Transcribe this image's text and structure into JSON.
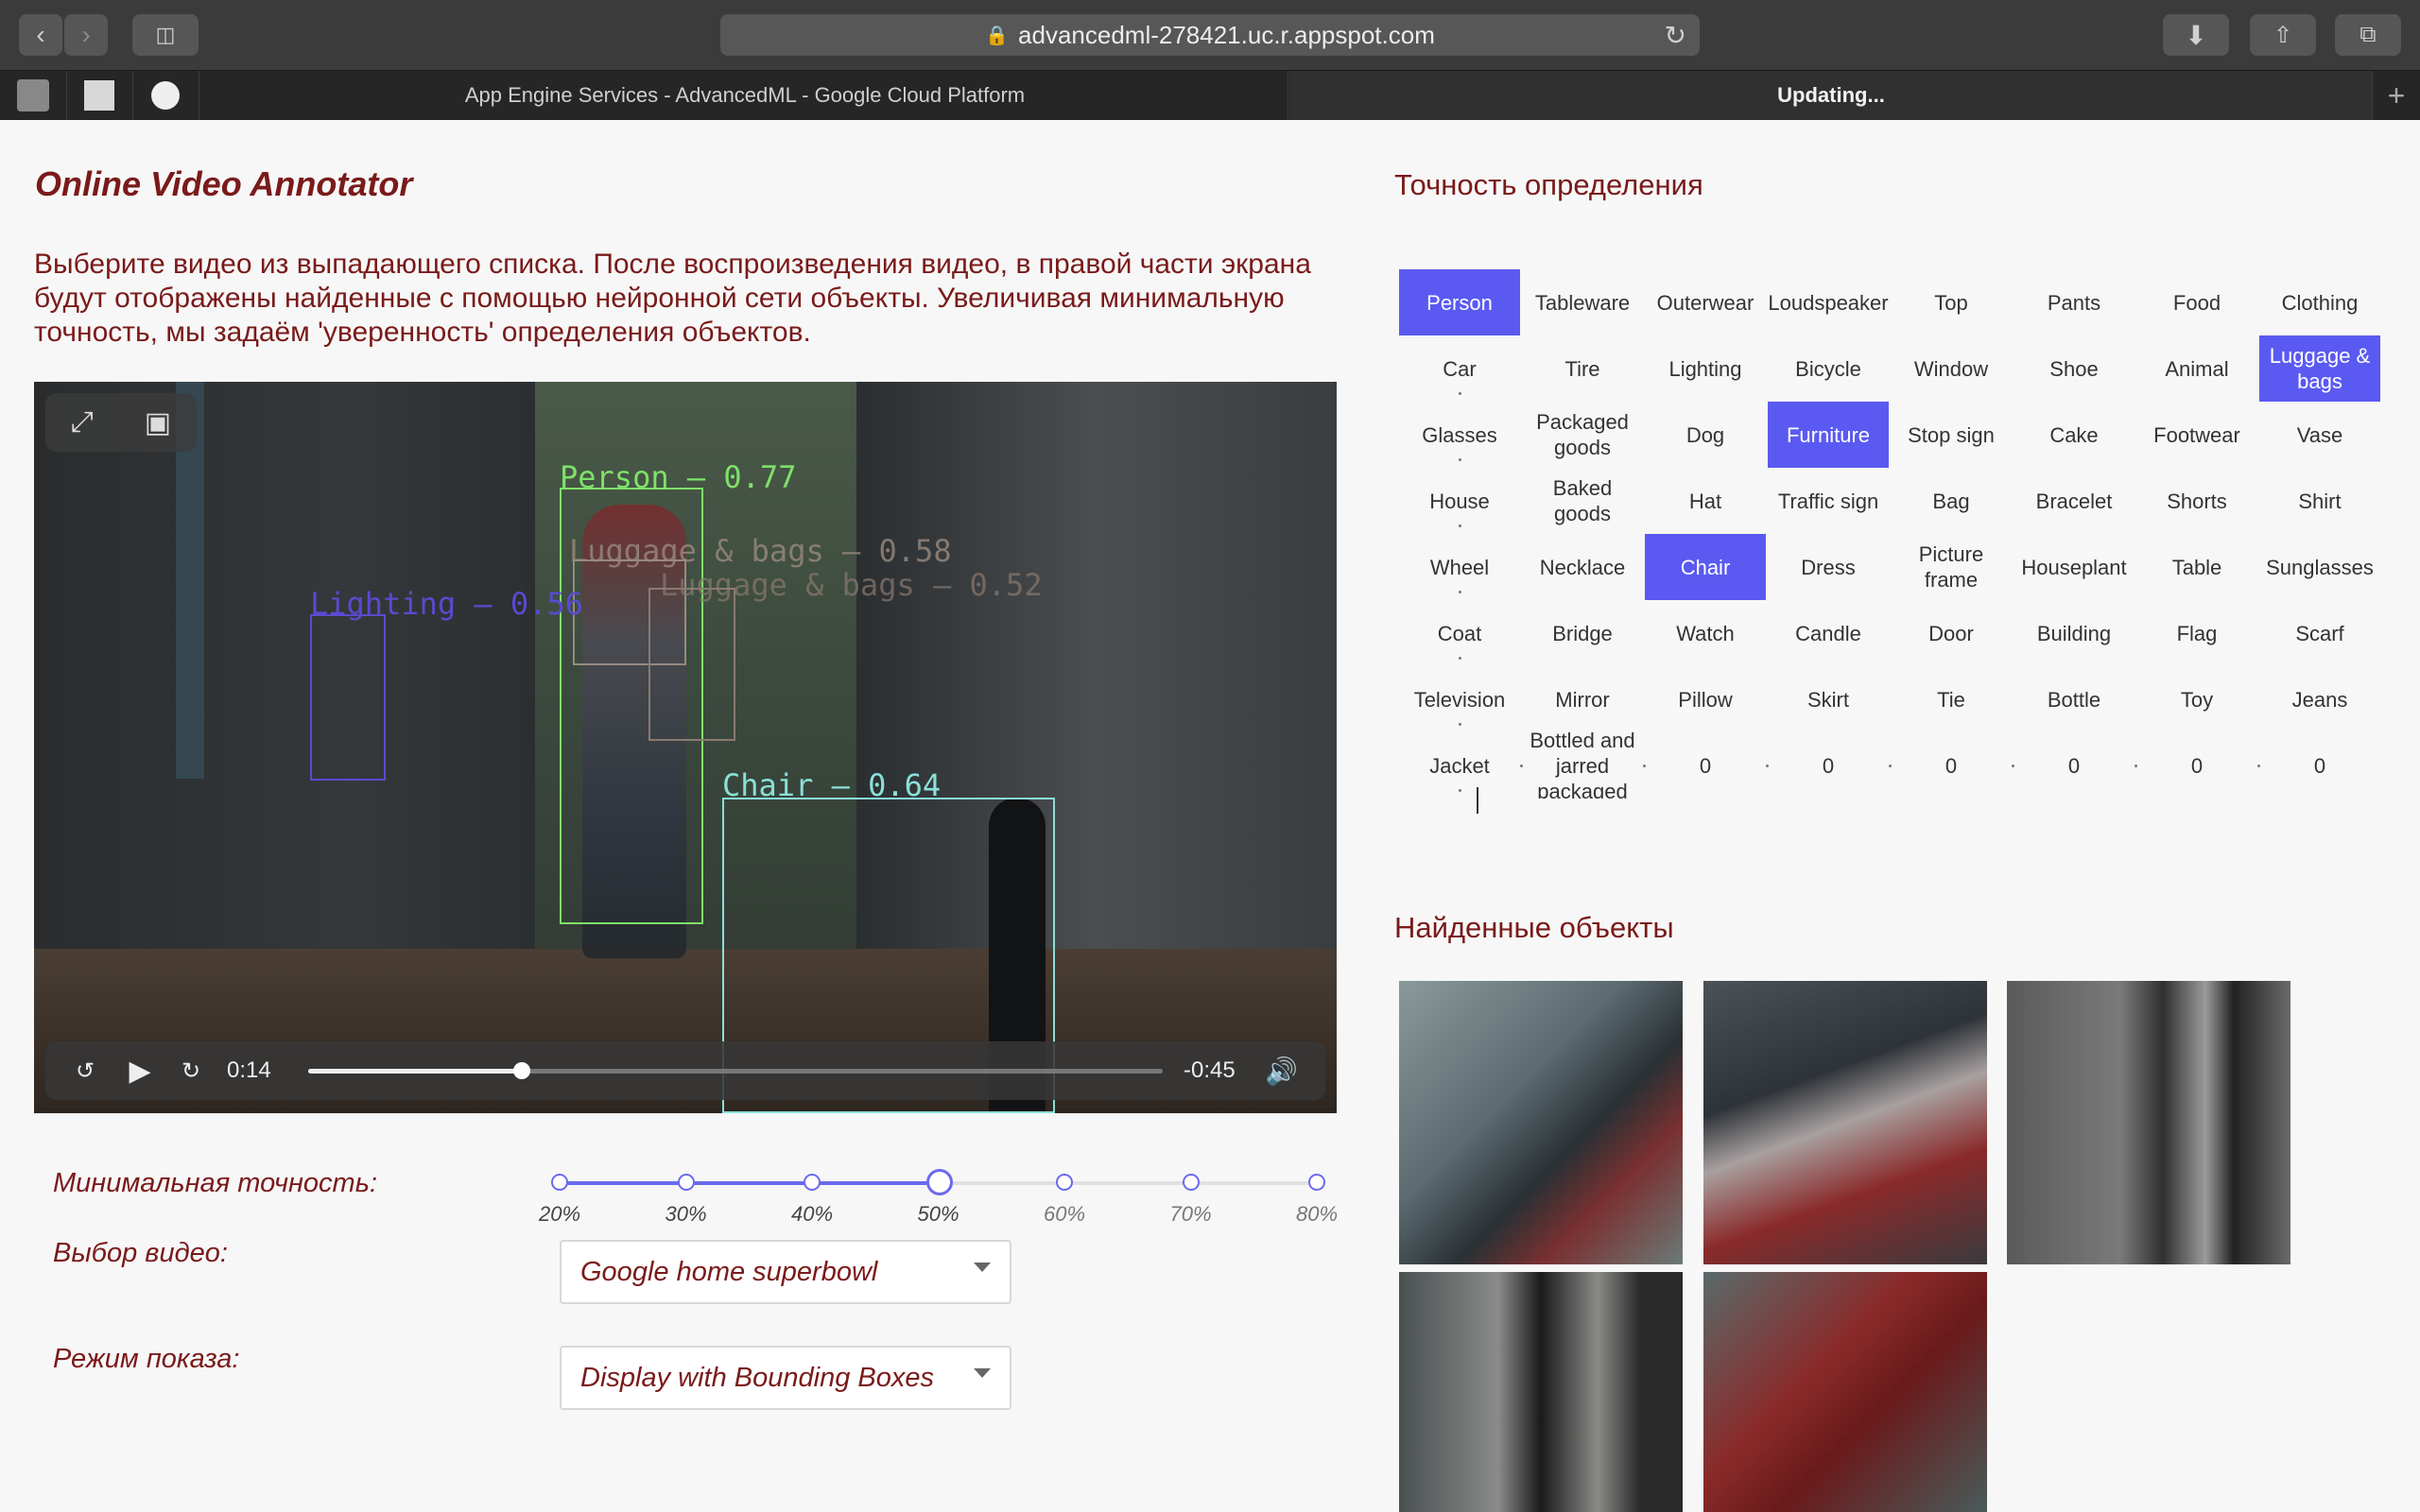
{
  "browser": {
    "url": "advancedml-278421.uc.r.appspot.com",
    "tabs": [
      {
        "label": "App Engine Services - AdvancedML - Google Cloud Platform"
      },
      {
        "label": "Updating..."
      }
    ],
    "new_tab": "+"
  },
  "page": {
    "title": "Online Video Annotator",
    "intro": "Выберите видео из выпадающего списка. После воспроизведения видео, в правой части экрана будут отображены найденные с помощью нейронной сети объекты. Увеличивая минимальную точность, мы задаём 'уверенность' определения объектов."
  },
  "video": {
    "detections": [
      {
        "label": "Person – 0.77",
        "color": "#7fe06a"
      },
      {
        "label": "Luggage & bags – 0.58",
        "color": "#9a8a80"
      },
      {
        "label": "Luggage & bags – 0.52",
        "color": "#8a7a70"
      },
      {
        "label": "Lighting – 0.56",
        "color": "#5a4ad0"
      },
      {
        "label": "Chair – 0.64",
        "color": "#8ae0d8"
      }
    ],
    "elapsed": "0:14",
    "remaining": "-0:45",
    "progress": 0.25,
    "skip_back": "15",
    "skip_fwd": "15"
  },
  "controls": {
    "min_accuracy_label": "Минимальная точность:",
    "slider_ticks": [
      "20%",
      "30%",
      "40%",
      "50%",
      "60%",
      "70%",
      "80%"
    ],
    "slider_selected": "50%",
    "video_label": "Выбор видео:",
    "video_value": "Google home superbowl",
    "mode_label": "Режим показа:",
    "mode_value": "Display with Bounding Boxes"
  },
  "accuracy": {
    "heading": "Точность определения",
    "selected_color": "#5a5af2",
    "rows": [
      [
        "Person",
        "Tableware",
        "Outerwear",
        "Loudspeaker",
        "Top",
        "Pants",
        "Food",
        "Clothing"
      ],
      [
        "Car",
        "Tire",
        "Lighting",
        "Bicycle",
        "Window",
        "Shoe",
        "Animal",
        "Luggage & bags"
      ],
      [
        "Glasses",
        "Packaged goods",
        "Dog",
        "Furniture",
        "Stop sign",
        "Cake",
        "Footwear",
        "Vase"
      ],
      [
        "House",
        "Baked goods",
        "Hat",
        "Traffic sign",
        "Bag",
        "Bracelet",
        "Shorts",
        "Shirt"
      ],
      [
        "Wheel",
        "Necklace",
        "Chair",
        "Dress",
        "Picture frame",
        "Houseplant",
        "Table",
        "Sunglasses"
      ],
      [
        "Coat",
        "Bridge",
        "Watch",
        "Candle",
        "Door",
        "Building",
        "Flag",
        "Scarf"
      ],
      [
        "Television",
        "Mirror",
        "Pillow",
        "Skirt",
        "Tie",
        "Bottle",
        "Toy",
        "Jeans"
      ],
      [
        "Jacket",
        "Bottled and jarred packaged",
        "0",
        "0",
        "0",
        "0",
        "0",
        "0"
      ]
    ],
    "selected": [
      "Person",
      "Luggage & bags",
      "Furniture",
      "Chair"
    ]
  },
  "found": {
    "heading": "Найденные объекты",
    "count": 5
  }
}
